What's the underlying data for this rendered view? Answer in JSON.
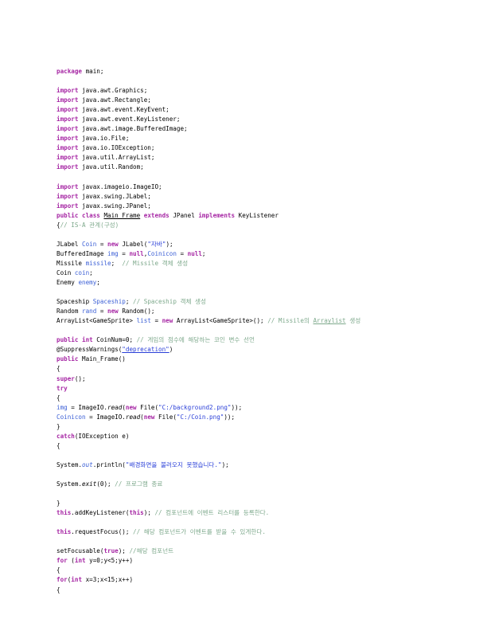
{
  "document": {
    "type": "source-code-listing",
    "language": "Java",
    "page_background": "#ffffff",
    "text_color": "#000000"
  },
  "colors": {
    "keyword": "#a626a4",
    "string": "#2a3fd8",
    "field": "#3b5fd6",
    "comment": "#7ea98c",
    "plain": "#000000"
  },
  "code": {
    "lines": [
      {
        "id": "l1",
        "indent": 0,
        "tokens": [
          {
            "t": "package",
            "c": "kw"
          },
          {
            "t": " main;",
            "c": "plain"
          }
        ]
      },
      {
        "id": "l2",
        "blank": true
      },
      {
        "id": "l3",
        "indent": 0,
        "tokens": [
          {
            "t": "import",
            "c": "kw"
          },
          {
            "t": " java.awt.Graphics;",
            "c": "plain"
          }
        ]
      },
      {
        "id": "l4",
        "indent": 0,
        "tokens": [
          {
            "t": "import",
            "c": "kw"
          },
          {
            "t": " java.awt.Rectangle;",
            "c": "plain"
          }
        ]
      },
      {
        "id": "l5",
        "indent": 0,
        "tokens": [
          {
            "t": "import",
            "c": "kw"
          },
          {
            "t": " java.awt.event.KeyEvent;",
            "c": "plain"
          }
        ]
      },
      {
        "id": "l6",
        "indent": 0,
        "tokens": [
          {
            "t": "import",
            "c": "kw"
          },
          {
            "t": " java.awt.event.KeyListener;",
            "c": "plain"
          }
        ]
      },
      {
        "id": "l7",
        "indent": 0,
        "tokens": [
          {
            "t": "import",
            "c": "kw"
          },
          {
            "t": " java.awt.image.BufferedImage;",
            "c": "plain"
          }
        ]
      },
      {
        "id": "l8",
        "indent": 0,
        "tokens": [
          {
            "t": "import",
            "c": "kw"
          },
          {
            "t": " java.io.File;",
            "c": "plain"
          }
        ]
      },
      {
        "id": "l9",
        "indent": 0,
        "tokens": [
          {
            "t": "import",
            "c": "kw"
          },
          {
            "t": " java.io.IOException;",
            "c": "plain"
          }
        ]
      },
      {
        "id": "l10",
        "indent": 0,
        "tokens": [
          {
            "t": "import",
            "c": "kw"
          },
          {
            "t": " java.util.ArrayList;",
            "c": "plain"
          }
        ]
      },
      {
        "id": "l11",
        "indent": 0,
        "tokens": [
          {
            "t": "import",
            "c": "kw"
          },
          {
            "t": " java.util.Random;",
            "c": "plain"
          }
        ]
      },
      {
        "id": "l12",
        "blank": true
      },
      {
        "id": "l13",
        "indent": 0,
        "tokens": [
          {
            "t": "import",
            "c": "kw"
          },
          {
            "t": " javax.imageio.ImageIO;",
            "c": "plain"
          }
        ]
      },
      {
        "id": "l14",
        "indent": 0,
        "tokens": [
          {
            "t": "import",
            "c": "kw"
          },
          {
            "t": " javax.swing.JLabel;",
            "c": "plain"
          }
        ]
      },
      {
        "id": "l15",
        "indent": 0,
        "tokens": [
          {
            "t": "import",
            "c": "kw"
          },
          {
            "t": " javax.swing.JPanel;",
            "c": "plain"
          }
        ]
      },
      {
        "id": "l16",
        "indent": 0,
        "tokens": [
          {
            "t": "public",
            "c": "kw"
          },
          {
            "t": " ",
            "c": "plain"
          },
          {
            "t": "class",
            "c": "kw"
          },
          {
            "t": " ",
            "c": "plain"
          },
          {
            "t": "Main_Frame",
            "c": "plain und"
          },
          {
            "t": " ",
            "c": "plain"
          },
          {
            "t": "extends",
            "c": "kw"
          },
          {
            "t": " JPanel ",
            "c": "plain"
          },
          {
            "t": "implements",
            "c": "kw"
          },
          {
            "t": " KeyListener",
            "c": "plain"
          }
        ]
      },
      {
        "id": "l17",
        "indent": 0,
        "tokens": [
          {
            "t": "{",
            "c": "plain"
          },
          {
            "t": "// IS-A 관계(구성)",
            "c": "cmt"
          }
        ]
      },
      {
        "id": "l18",
        "blank": true
      },
      {
        "id": "l19",
        "indent": 1,
        "tokens": [
          {
            "t": "JLabel ",
            "c": "plain"
          },
          {
            "t": "Coin",
            "c": "fld"
          },
          {
            "t": " = ",
            "c": "plain"
          },
          {
            "t": "new",
            "c": "kw"
          },
          {
            "t": " JLabel(",
            "c": "plain"
          },
          {
            "t": "\"자바\"",
            "c": "str"
          },
          {
            "t": ");",
            "c": "plain"
          }
        ]
      },
      {
        "id": "l20",
        "indent": 1,
        "tokens": [
          {
            "t": "BufferedImage ",
            "c": "plain"
          },
          {
            "t": "img",
            "c": "fld"
          },
          {
            "t": " = ",
            "c": "plain"
          },
          {
            "t": "null",
            "c": "kw"
          },
          {
            "t": ",",
            "c": "plain"
          },
          {
            "t": "Coinicon",
            "c": "fld"
          },
          {
            "t": " = ",
            "c": "plain"
          },
          {
            "t": "null",
            "c": "kw"
          },
          {
            "t": ";",
            "c": "plain"
          }
        ]
      },
      {
        "id": "l21",
        "indent": 1,
        "tokens": [
          {
            "t": "Missile ",
            "c": "plain"
          },
          {
            "t": "missile",
            "c": "fld"
          },
          {
            "t": ";  ",
            "c": "plain"
          },
          {
            "t": "// Missile 객체 생성",
            "c": "cmt"
          }
        ]
      },
      {
        "id": "l22",
        "indent": 1,
        "tokens": [
          {
            "t": "Coin ",
            "c": "plain"
          },
          {
            "t": "coin",
            "c": "fld"
          },
          {
            "t": ";",
            "c": "plain"
          }
        ]
      },
      {
        "id": "l23",
        "indent": 1,
        "tokens": [
          {
            "t": "Enemy ",
            "c": "plain"
          },
          {
            "t": "enemy",
            "c": "fld"
          },
          {
            "t": ";",
            "c": "plain"
          }
        ]
      },
      {
        "id": "l24",
        "blank": true
      },
      {
        "id": "l25",
        "indent": 1,
        "tokens": [
          {
            "t": "Spaceship ",
            "c": "plain"
          },
          {
            "t": "Spaceship",
            "c": "fld"
          },
          {
            "t": "; ",
            "c": "plain"
          },
          {
            "t": "// Spaceship 객체 생성",
            "c": "cmt"
          }
        ]
      },
      {
        "id": "l26",
        "indent": 1,
        "tokens": [
          {
            "t": "Random ",
            "c": "plain"
          },
          {
            "t": "rand",
            "c": "fld"
          },
          {
            "t": " = ",
            "c": "plain"
          },
          {
            "t": "new",
            "c": "kw"
          },
          {
            "t": " Random();",
            "c": "plain"
          }
        ]
      },
      {
        "id": "l27",
        "indent": 1,
        "wrap": true,
        "tokens": [
          {
            "t": "ArrayList<GameSprite> ",
            "c": "plain"
          },
          {
            "t": "list",
            "c": "fld"
          },
          {
            "t": " = ",
            "c": "plain"
          },
          {
            "t": "new",
            "c": "kw"
          },
          {
            "t": " ArrayList<GameSprite>(); ",
            "c": "plain"
          },
          {
            "t": "// Missile의 ",
            "c": "cmt"
          },
          {
            "t": "Arraylist",
            "c": "cmt und"
          },
          {
            "t": " 생성",
            "c": "cmt"
          }
        ]
      },
      {
        "id": "l28",
        "blank": true
      },
      {
        "id": "l29",
        "indent": 1,
        "tokens": [
          {
            "t": "public",
            "c": "kw"
          },
          {
            "t": " ",
            "c": "plain"
          },
          {
            "t": "int",
            "c": "kw"
          },
          {
            "t": " CoinNum=0; ",
            "c": "plain"
          },
          {
            "t": "// 게임의 점수에 해당하는 코인 변수 선언",
            "c": "cmt"
          }
        ]
      },
      {
        "id": "l30",
        "indent": 1,
        "tokens": [
          {
            "t": "@SuppressWarnings(",
            "c": "plain"
          },
          {
            "t": "\"deprecation\"",
            "c": "str und"
          },
          {
            "t": ")",
            "c": "plain"
          }
        ]
      },
      {
        "id": "l31",
        "indent": 1,
        "tokens": [
          {
            "t": "public",
            "c": "kw"
          },
          {
            "t": " Main_Frame()",
            "c": "plain"
          }
        ]
      },
      {
        "id": "l32",
        "indent": 1,
        "tokens": [
          {
            "t": "{",
            "c": "plain"
          }
        ]
      },
      {
        "id": "l33",
        "indent": 2,
        "tokens": [
          {
            "t": "super",
            "c": "kw"
          },
          {
            "t": "();",
            "c": "plain"
          }
        ]
      },
      {
        "id": "l34",
        "indent": 2,
        "tokens": [
          {
            "t": "try",
            "c": "kw"
          }
        ]
      },
      {
        "id": "l35",
        "indent": 2,
        "tokens": [
          {
            "t": "{",
            "c": "plain"
          }
        ]
      },
      {
        "id": "l36",
        "indent": 3,
        "tokens": [
          {
            "t": "img",
            "c": "fld"
          },
          {
            "t": " = ImageIO.",
            "c": "plain"
          },
          {
            "t": "read",
            "c": "plain it"
          },
          {
            "t": "(",
            "c": "plain"
          },
          {
            "t": "new",
            "c": "kw"
          },
          {
            "t": " File(",
            "c": "plain"
          },
          {
            "t": "\"C:/background2.png\"",
            "c": "str"
          },
          {
            "t": "));",
            "c": "plain"
          }
        ]
      },
      {
        "id": "l37",
        "indent": 3,
        "tokens": [
          {
            "t": "Coinicon",
            "c": "fld"
          },
          {
            "t": " = ImageIO.",
            "c": "plain"
          },
          {
            "t": "read",
            "c": "plain it"
          },
          {
            "t": "(",
            "c": "plain"
          },
          {
            "t": "new",
            "c": "kw"
          },
          {
            "t": " File(",
            "c": "plain"
          },
          {
            "t": "\"C:/Coin.png\"",
            "c": "str"
          },
          {
            "t": "));",
            "c": "plain"
          }
        ]
      },
      {
        "id": "l38",
        "indent": 2,
        "tokens": [
          {
            "t": "}",
            "c": "plain"
          }
        ]
      },
      {
        "id": "l39",
        "indent": 2,
        "tokens": [
          {
            "t": "catch",
            "c": "kw"
          },
          {
            "t": "(IOException e)",
            "c": "plain"
          }
        ]
      },
      {
        "id": "l40",
        "indent": 2,
        "tokens": [
          {
            "t": "{",
            "c": "plain"
          }
        ]
      },
      {
        "id": "l41",
        "blank": true
      },
      {
        "id": "l42",
        "indent": 3,
        "tokens": [
          {
            "t": "System.",
            "c": "plain"
          },
          {
            "t": "out",
            "c": "fld it"
          },
          {
            "t": ".println(",
            "c": "plain"
          },
          {
            "t": "\"배경화면을 불러오지 못했습니다.\"",
            "c": "str"
          },
          {
            "t": ");",
            "c": "plain"
          }
        ]
      },
      {
        "id": "l43",
        "blank": true
      },
      {
        "id": "l44",
        "indent": 3,
        "tokens": [
          {
            "t": "System.",
            "c": "plain"
          },
          {
            "t": "exit",
            "c": "plain it"
          },
          {
            "t": "(0); ",
            "c": "plain"
          },
          {
            "t": "// 프로그램 종료",
            "c": "cmt"
          }
        ]
      },
      {
        "id": "l45",
        "blank": true
      },
      {
        "id": "l46",
        "indent": 2,
        "tokens": [
          {
            "t": "}",
            "c": "plain"
          }
        ]
      },
      {
        "id": "l47",
        "indent": 2,
        "tokens": [
          {
            "t": "this",
            "c": "kw"
          },
          {
            "t": ".addKeyListener(",
            "c": "plain"
          },
          {
            "t": "this",
            "c": "kw"
          },
          {
            "t": "); ",
            "c": "plain"
          },
          {
            "t": "// 컴포넌트에 이벤트 리스터를 등록한다.",
            "c": "cmt"
          }
        ]
      },
      {
        "id": "l48",
        "blank": true
      },
      {
        "id": "l49",
        "indent": 2,
        "tokens": [
          {
            "t": "this",
            "c": "kw"
          },
          {
            "t": ".requestFocus(); ",
            "c": "plain"
          },
          {
            "t": "// 해당 컴포넌트가 이벤트를 받을 수 있게한다.",
            "c": "cmt"
          }
        ]
      },
      {
        "id": "l50",
        "blank": true
      },
      {
        "id": "l51",
        "indent": 2,
        "tokens": [
          {
            "t": "setFocusable(",
            "c": "plain"
          },
          {
            "t": "true",
            "c": "kw"
          },
          {
            "t": "); ",
            "c": "plain"
          },
          {
            "t": "//해당 컴포넌트",
            "c": "cmt"
          }
        ]
      },
      {
        "id": "l52",
        "indent": 2,
        "tokens": [
          {
            "t": "for",
            "c": "kw"
          },
          {
            "t": " (",
            "c": "plain"
          },
          {
            "t": "int",
            "c": "kw"
          },
          {
            "t": " y=0;y<5;y++)",
            "c": "plain"
          }
        ]
      },
      {
        "id": "l53",
        "indent": 2,
        "tokens": [
          {
            "t": "{",
            "c": "plain"
          }
        ]
      },
      {
        "id": "l54",
        "indent": 3,
        "tokens": [
          {
            "t": "for",
            "c": "kw"
          },
          {
            "t": "(",
            "c": "plain"
          },
          {
            "t": "int",
            "c": "kw"
          },
          {
            "t": " x=3;x<15;x++)",
            "c": "plain"
          }
        ]
      },
      {
        "id": "l55",
        "indent": 3,
        "tokens": [
          {
            "t": "{",
            "c": "plain"
          }
        ]
      }
    ]
  }
}
